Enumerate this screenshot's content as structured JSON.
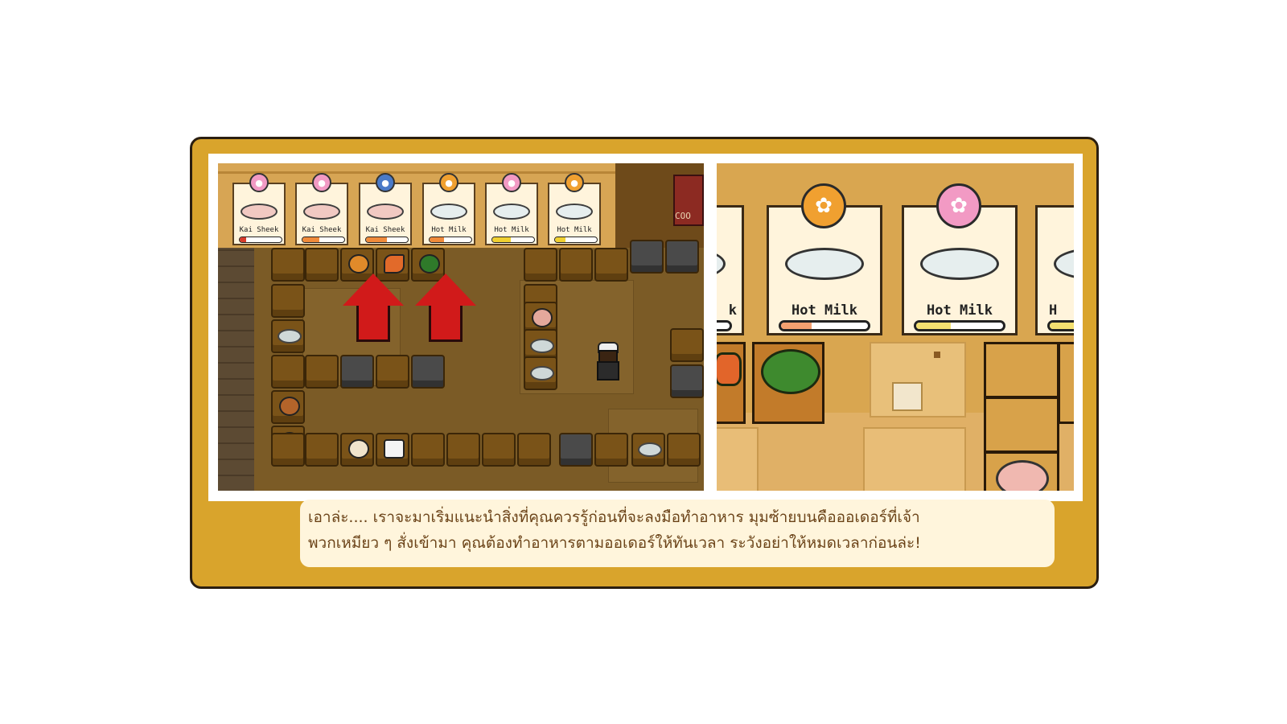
{
  "left_orders": [
    {
      "dish": "Kai Sheek",
      "paw_color": "#f29ac4",
      "bar_color": "#d83c2c",
      "progress": 0.15,
      "meat": true
    },
    {
      "dish": "Kai Sheek",
      "paw_color": "#f29ac4",
      "bar_color": "#f08a3a",
      "progress": 0.4,
      "meat": true
    },
    {
      "dish": "Kai Sheek",
      "paw_color": "#4a7ac8",
      "bar_color": "#f08a3a",
      "progress": 0.5,
      "meat": true
    },
    {
      "dish": "Hot Milk",
      "paw_color": "#f0a030",
      "bar_color": "#f08a3a",
      "progress": 0.35,
      "meat": false
    },
    {
      "dish": "Hot Milk",
      "paw_color": "#f29ac4",
      "bar_color": "#f0d030",
      "progress": 0.45,
      "meat": false
    },
    {
      "dish": "Hot Milk",
      "paw_color": "#f0a030",
      "bar_color": "#f0d030",
      "progress": 0.25,
      "meat": false
    }
  ],
  "right_orders": [
    {
      "dish": "Hot Milk",
      "paw_color": "#f0a030",
      "bar_color": "#f4a070",
      "progress": 0.35
    },
    {
      "dish": "Hot Milk",
      "paw_color": "#f29ac4",
      "bar_color": "#f4e070",
      "progress": 0.4
    }
  ],
  "partial_card_left_text": "k",
  "partial_card_right_text": "H",
  "sign_text": "COO",
  "caption": {
    "line1": "เอาล่ะ.... เราจะมาเริ่มแนะนำสิ่งที่คุณควรรู้ก่อนที่จะลงมือทำอาหาร มุมซ้ายบนคือออเดอร์ที่เจ้า",
    "line2": "พวกเหมียว ๆ สั่งเข้ามา คุณต้องทำอาหารตามออเดอร์ให้ทันเวลา ระวังอย่าให้หมดเวลาก่อนล่ะ!"
  },
  "colors": {
    "frame": "#d9a42c",
    "arrow": "#d11a1a",
    "caption_text": "#6b4318"
  },
  "icons": {
    "paw": "paw-icon",
    "arrow": "up-arrow-icon"
  }
}
